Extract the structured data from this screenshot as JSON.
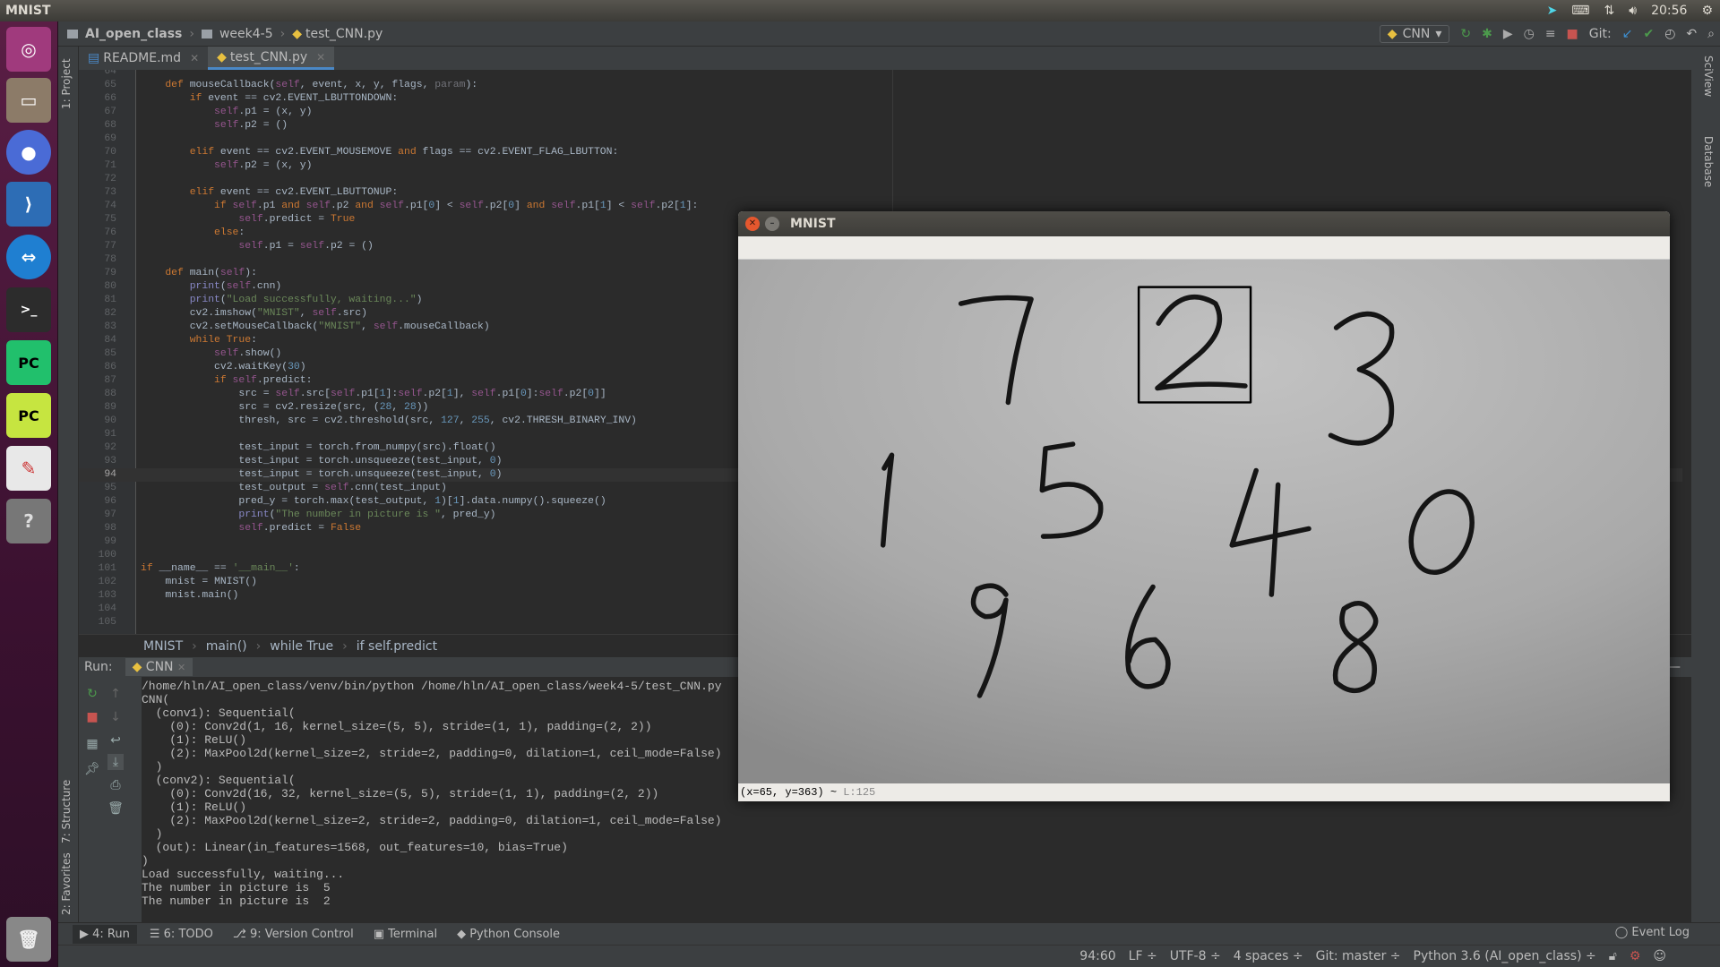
{
  "topbar": {
    "title": "MNIST",
    "time": "20:56"
  },
  "nav": {
    "crumbs": [
      "AI_open_class",
      "week4-5",
      "test_CNN.py"
    ]
  },
  "toolbar": {
    "run_config": "CNN",
    "git_label": "Git:"
  },
  "tabs": [
    {
      "label": "README.md",
      "active": false
    },
    {
      "label": "test_CNN.py",
      "active": true
    }
  ],
  "side_tools": {
    "left": [
      "1: Project",
      "7: Structure",
      "2: Favorites"
    ],
    "right": [
      "SciView",
      "Database"
    ]
  },
  "editor": {
    "first_line": 64,
    "current_line": 94,
    "lines": [
      "",
      "    def mouseCallback(self, event, x, y, flags, param):",
      "        if event == cv2.EVENT_LBUTTONDOWN:",
      "            self.p1 = (x, y)",
      "            self.p2 = ()",
      "",
      "        elif event == cv2.EVENT_MOUSEMOVE and flags == cv2.EVENT_FLAG_LBUTTON:",
      "            self.p2 = (x, y)",
      "",
      "        elif event == cv2.EVENT_LBUTTONUP:",
      "            if self.p1 and self.p2 and self.p1[0] < self.p2[0] and self.p1[1] < self.p2[1]:",
      "                self.predict = True",
      "            else:",
      "                self.p1 = self.p2 = ()",
      "",
      "    def main(self):",
      "        print(self.cnn)",
      "        print(\"Load successfully, waiting...\")",
      "        cv2.imshow(\"MNIST\", self.src)",
      "        cv2.setMouseCallback(\"MNIST\", self.mouseCallback)",
      "        while True:",
      "            self.show()",
      "            cv2.waitKey(30)",
      "            if self.predict:",
      "                src = self.src[self.p1[1]:self.p2[1], self.p1[0]:self.p2[0]]",
      "                src = cv2.resize(src, (28, 28))",
      "                thresh, src = cv2.threshold(src, 127, 255, cv2.THRESH_BINARY_INV)",
      "",
      "                test_input = torch.from_numpy(src).float()",
      "                test_input = torch.unsqueeze(test_input, 0)",
      "                test_input = torch.unsqueeze(test_input, 0)",
      "                test_output = self.cnn(test_input)",
      "                pred_y = torch.max(test_output, 1)[1].data.numpy().squeeze()",
      "                print(\"The number in picture is \", pred_y)",
      "                self.predict = False",
      "",
      "",
      "if __name__ == '__main__':",
      "    mnist = MNIST()",
      "    mnist.main()",
      "",
      ""
    ]
  },
  "breadcrumb": [
    "MNIST",
    "main()",
    "while True",
    "if self.predict"
  ],
  "run": {
    "label": "Run:",
    "tab": "CNN",
    "output": [
      "/home/hln/AI_open_class/venv/bin/python /home/hln/AI_open_class/week4-5/test_CNN.py",
      "CNN(",
      "  (conv1): Sequential(",
      "    (0): Conv2d(1, 16, kernel_size=(5, 5), stride=(1, 1), padding=(2, 2))",
      "    (1): ReLU()",
      "    (2): MaxPool2d(kernel_size=2, stride=2, padding=0, dilation=1, ceil_mode=False)",
      "  )",
      "  (conv2): Sequential(",
      "    (0): Conv2d(16, 32, kernel_size=(5, 5), stride=(1, 1), padding=(2, 2))",
      "    (1): ReLU()",
      "    (2): MaxPool2d(kernel_size=2, stride=2, padding=0, dilation=1, ceil_mode=False)",
      "  )",
      "  (out): Linear(in_features=1568, out_features=10, bias=True)",
      ")",
      "Load successfully, waiting...",
      "The number in picture is  5",
      "The number in picture is  2"
    ]
  },
  "bottom_tabs": [
    "4: Run",
    "6: TODO",
    "9: Version Control",
    "Terminal",
    "Python Console"
  ],
  "event_log": "Event Log",
  "status": {
    "position": "94:60",
    "line_sep": "LF ÷",
    "encoding": "UTF-8 ÷",
    "indent": "4 spaces ÷",
    "git": "Git: master ÷",
    "interpreter": "Python 3.6 (AI_open_class) ÷"
  },
  "mnist_window": {
    "title": "MNIST",
    "status": "(x=65, y=363) ~ ",
    "status_level": "L:125"
  },
  "colors": {
    "keyword": "#cc7832",
    "self": "#94558d",
    "string": "#6a8759",
    "number": "#6897bb",
    "accent": "#4a88c7"
  }
}
